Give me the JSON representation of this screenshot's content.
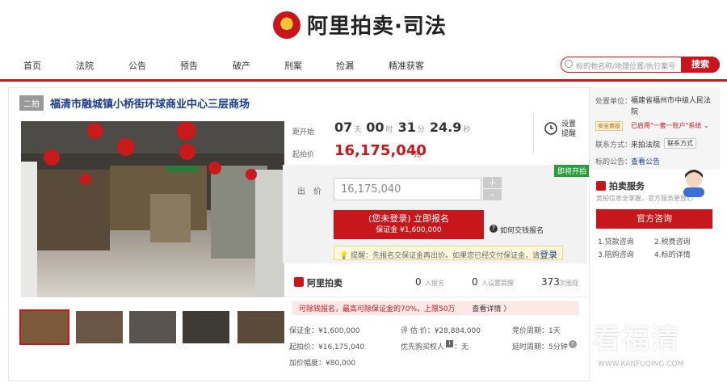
{
  "header": {
    "logo_emblem": "⚖",
    "logo_text": "阿里拍卖·司法"
  },
  "nav": {
    "items": [
      "首页",
      "法院",
      "公告",
      "预告",
      "破产",
      "刑案",
      "捡漏",
      "精准获客"
    ]
  },
  "search": {
    "placeholder": "标的物名称/地理位置/执行案号",
    "button": "搜索"
  },
  "auction": {
    "round_badge": "二拍",
    "title": "福清市融城镇小桥街环球商业中心三层商场",
    "countdown_label": "距开始",
    "cd_days": "07",
    "cd_days_unit": "天",
    "cd_hours": "00",
    "cd_hours_unit": "时",
    "cd_min": "31",
    "cd_min_unit": "分",
    "cd_sec": "24.9",
    "cd_sec_unit": "秒",
    "start_price_label": "起拍价",
    "start_price": "16,175,040",
    "start_price_unit": "元",
    "remind_label_1": "设置",
    "remind_label_2": "提醒",
    "instant_badge": "即将开拍",
    "bid_label": "出　价",
    "bid_value": "16,175,040",
    "plus": "+",
    "minus": "-",
    "register_line1": "(您未登录) 立即报名",
    "register_line2": "保证金 ¥1,600,000",
    "how_pay": "如何交钱报名",
    "tip_text": "提醒：先报名交保证金再出价。如果您已经交付保证金，请",
    "tip_login": "登录",
    "brand": "阿里拍卖",
    "stat1_num": "0",
    "stat1_label": "人报名",
    "stat2_num": "0",
    "stat2_label": "人设置提醒",
    "stat3_num": "373",
    "stat3_label": "次围观",
    "loan_tip": "可除钱报名，最高可除保证金的70%，上限50万",
    "loan_more": "查看详情 〉",
    "details": {
      "deposit": "保证金：¥1,600,000",
      "appraisal": "评 估 价：¥28,884,000",
      "cycle": "竞价周期：1天",
      "start": "起拍价：¥16,175,040",
      "priority": "优先购买权人",
      "priority_val": "：无",
      "extend": "延时周期：5分钟",
      "increment": "加价幅度：¥80,000"
    }
  },
  "sidebar": {
    "unit_label": "处置单位：",
    "unit_value": "福建省福州市中级人民法院",
    "safe_badge": "安全商投",
    "safe_text": "已启用\"一套一账户\"系统 ⌄",
    "contact_label": "联系方式：",
    "contact_value": "来拍法院",
    "contact_btn": "联系方式",
    "notice_label": "标的公告：",
    "notice_link": "查看公告",
    "service_title": "拍卖服务",
    "service_desc": "竞拍信息全掌握，官方服务更放心",
    "service_btn": "官方咨询",
    "links": [
      "1.贷款咨询",
      "2.税费咨询",
      "3.陪购咨询",
      "4.标的详情"
    ],
    "watermark": "看福清",
    "watermark2": "WWW.KANFUQING.COM"
  },
  "colors": {
    "brand": "#c8161d",
    "link": "#1a3d8f",
    "green": "#2a9d3a"
  }
}
